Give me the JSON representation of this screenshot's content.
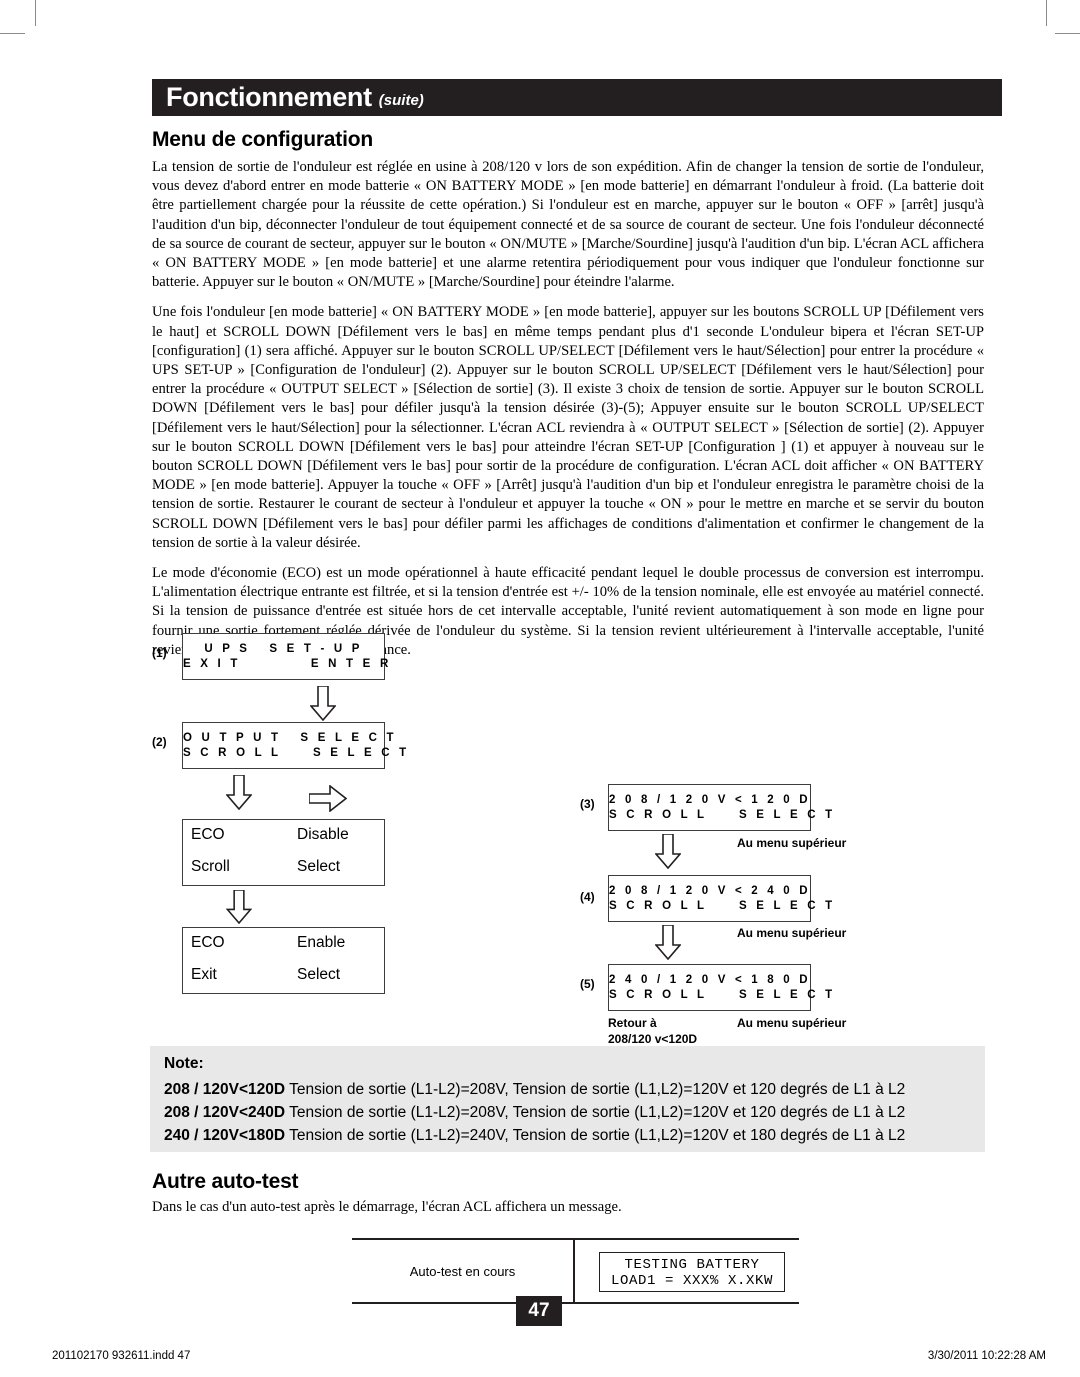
{
  "header": {
    "title": "Fonctionnement",
    "suffix": "(suite)"
  },
  "sections": {
    "menu_heading": "Menu de configuration",
    "autotest_heading": "Autre auto-test",
    "autotest_intro": "Dans le cas d'un auto-test après le démarrage, l'écran ACL affichera un message."
  },
  "paragraphs": [
    "La tension de sortie de l'onduleur est réglée en usine à 208/120 v lors de son expédition. Afin de changer la tension de sortie de l'onduleur, vous devez d'abord entrer en mode batterie « ON BATTERY MODE » [en mode batterie] en démarrant l'onduleur à froid. (La batterie doit être partiellement chargée pour la réussite de cette opération.) Si l'onduleur est en marche, appuyer sur le bouton « OFF » [arrêt] jusqu'à l'audition d'un bip, déconnecter l'onduleur de tout équipement connecté et de sa source de courant de secteur. Une fois l'onduleur déconnecté de sa source de courant de secteur, appuyer sur le bouton « ON/MUTE » [Marche/Sourdine] jusqu'à l'audition d'un bip. L'écran ACL affichera « ON BATTERY MODE » [en mode batterie] et une alarme retentira périodiquement pour vous indiquer que l'onduleur fonctionne sur batterie. Appuyer sur le bouton « ON/MUTE » [Marche/Sourdine] pour éteindre l'alarme.",
    "Une fois l'onduleur [en mode batterie] « ON BATTERY MODE » [en mode batterie], appuyer sur les boutons SCROLL UP [Défilement vers le haut] et SCROLL DOWN [Défilement vers le bas] en même temps pendant plus d'1 seconde L'onduleur bipera et l'écran SET-UP [configuration] (1) sera affiché. Appuyer sur le bouton SCROLL UP/SELECT [Défilement vers le haut/Sélection] pour entrer la procédure « UPS SET-UP » [Configuration de l'onduleur] (2). Appuyer sur le bouton SCROLL UP/SELECT [Défilement vers le haut/Sélection] pour entrer la procédure « OUTPUT SELECT » [Sélection de sortie] (3). Il existe 3 choix de tension de sortie. Appuyer sur le bouton SCROLL DOWN [Défilement vers le bas] pour défiler jusqu'à la tension désirée (3)-(5); Appuyer ensuite sur le bouton SCROLL UP/SELECT [Défilement vers le haut/Sélection] pour la sélectionner. L'écran ACL reviendra à « OUTPUT SELECT » [Sélection de sortie] (2). Appuyer sur le bouton SCROLL DOWN [Défilement vers le bas] pour atteindre l'écran SET-UP [Configuration ] (1) et appuyer à nouveau sur le bouton SCROLL DOWN [Défilement vers le bas] pour sortir de la procédure de configuration. L'écran ACL doit afficher « ON BATTERY MODE » [en mode batterie]. Appuyer la touche « OFF » [Arrêt] jusqu'à l'audition d'un bip et l'onduleur enregistra le paramètre choisi de la tension de sortie. Restaurer le courant de secteur à l'onduleur et appuyer la touche « ON » pour le mettre en marche et se servir du bouton SCROLL DOWN [Défilement vers le bas] pour défiler parmi les affichages de conditions d'alimentation et confirmer le changement de la tension de sortie à la valeur désirée.",
    "Le mode d'économie (ECO) est un mode opérationnel à haute efficacité pendant lequel le double processus de conversion est interrompu. L'alimentation électrique entrante est filtrée, et si la tension d'entrée est +/- 10% de la tension nominale, elle est envoyée au matériel connecté. Si la tension de puissance d'entrée est située hors de cet intervalle acceptable, l'unité revient automatiquement à son mode en ligne pour fournir une sortie fortement réglée dérivée de l'onduleur du système. Si la tension revient ultérieurement à l'intervalle acceptable, l'unité reviendra à son mode de haute performance."
  ],
  "diagram": {
    "step1": {
      "num": "(1)",
      "line1": "U P S   S E T - U P",
      "line2": "E X I T           E N T E R"
    },
    "step2": {
      "num": "(2)",
      "line1": "O U T P U T   S E L E C T",
      "line2": "S C R O L L     S E L E C T"
    },
    "step3": {
      "num": "(3)",
      "line1": "2 0 8 / 1 2 0 V < 1 2 0 D",
      "line2": "S C R O L L     S E L E C T",
      "side": "Au menu supérieur"
    },
    "step4": {
      "num": "(4)",
      "line1": "2 0 8 / 1 2 0 V < 2 4 0 D",
      "line2": "S C R O L L     S E L E C T",
      "side": "Au menu supérieur"
    },
    "step5": {
      "num": "(5)",
      "line1": "2 4 0 / 1 2 0 V < 1 8 0 D",
      "line2": "S C R O L L     S E L E C T",
      "side": "Au menu supérieur"
    },
    "return_label_1": "Retour à",
    "return_label_2": "208/120 v<120D",
    "eco_disable": {
      "l1": "ECO",
      "r1": "Disable",
      "l2": "Scroll",
      "r2": "Select"
    },
    "eco_enable": {
      "l1": "ECO",
      "r1": "Enable",
      "l2": "Exit",
      "r2": "Select"
    }
  },
  "note": {
    "title": "Note:",
    "rows": [
      {
        "code": "208 / 120V<120D",
        "text": " Tension de sortie (L1-L2)=208V, Tension de sortie (L1,L2)=120V et 120 degrés de L1 à L2"
      },
      {
        "code": "208 / 120V<240D",
        "text": " Tension de sortie (L1-L2)=208V, Tension de sortie (L1,L2)=120V et 120 degrés de L1 à L2"
      },
      {
        "code": "240 / 120V<180D",
        "text": " Tension de sortie (L1-L2)=240V, Tension de sortie (L1,L2)=120V et 180 degrés de L1 à L2"
      }
    ]
  },
  "autotest_table": {
    "label": "Auto-test en cours",
    "lcd_line1": "TESTING BATTERY",
    "lcd_line2": "LOAD1 = XXX% X.XKW"
  },
  "page_number": "47",
  "footer": {
    "left": "201102170 932611.indd  47",
    "right": "3/30/2011  10:22:28 AM"
  },
  "colors": {
    "header_bar": "#231f20",
    "note_bg": "#e8e8e8",
    "rule": "#231f20"
  }
}
